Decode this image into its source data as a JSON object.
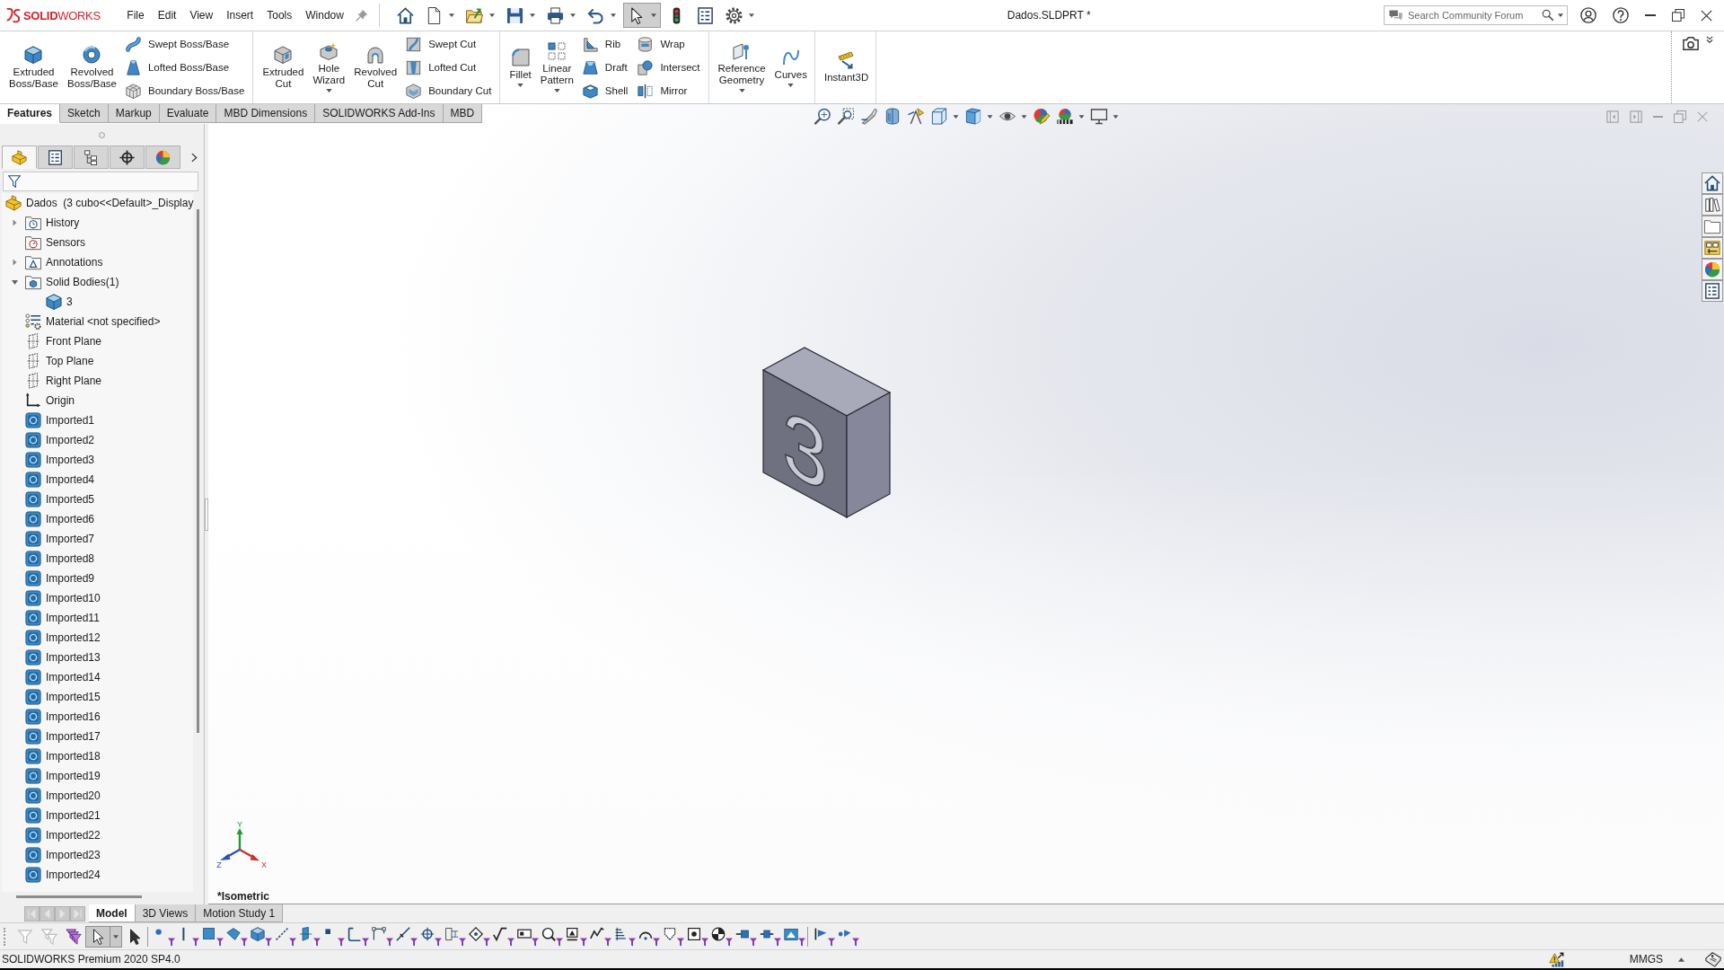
{
  "titlebar": {
    "logo": "**SOLID**WORKS",
    "menus": [
      "File",
      "Edit",
      "View",
      "Insert",
      "Tools",
      "Window"
    ],
    "quick_tools": [
      {
        "dropdown": false,
        "selected": false
      },
      {
        "dropdown": true,
        "selected": false
      },
      {
        "dropdown": true,
        "selected": false
      },
      {
        "dropdown": true,
        "selected": false
      },
      {
        "dropdown": true,
        "selected": false
      },
      {
        "dropdown": true,
        "selected": false
      },
      {
        "dropdown": true,
        "selected": true
      },
      {
        "dropdown": false,
        "selected": false
      },
      {
        "dropdown": false,
        "selected": false
      },
      {
        "dropdown": true,
        "selected": false
      }
    ],
    "title": "Dados.SLDPRT *",
    "search": {
      "placeholder": "Search Community Forum"
    }
  },
  "ribbon": {
    "groups": [
      {
        "columns": [
          {
            "kind": "large",
            "label": "Extruded\nBoss/Base",
            "dropdown": false
          },
          {
            "kind": "large",
            "label": "Revolved\nBoss/Base",
            "dropdown": false
          },
          {
            "kind": "stack",
            "items": [
              "Swept Boss/Base",
              "Lofted Boss/Base",
              "Boundary Boss/Base"
            ]
          }
        ]
      },
      {
        "columns": [
          {
            "kind": "large",
            "label": "Extruded\nCut",
            "dropdown": false
          },
          {
            "kind": "large",
            "label": "Hole\nWizard",
            "dropdown": true
          },
          {
            "kind": "large",
            "label": "Revolved\nCut",
            "dropdown": false
          },
          {
            "kind": "stack",
            "items": [
              "Swept Cut",
              "Lofted Cut",
              "Boundary Cut"
            ]
          }
        ]
      },
      {
        "columns": [
          {
            "kind": "large",
            "label": "Fillet",
            "dropdown": true
          },
          {
            "kind": "large",
            "label": "Linear\nPattern",
            "dropdown": true
          },
          {
            "kind": "stack",
            "items": [
              "Rib",
              "Draft",
              "Shell"
            ]
          },
          {
            "kind": "stack",
            "items": [
              "Wrap",
              "Intersect",
              "Mirror"
            ]
          }
        ]
      },
      {
        "columns": [
          {
            "kind": "large",
            "label": "Reference\nGeometry",
            "dropdown": true
          },
          {
            "kind": "large",
            "label": "Curves",
            "dropdown": true
          }
        ]
      },
      {
        "columns": [
          {
            "kind": "large",
            "label": "Instant3D",
            "dropdown": false
          }
        ]
      }
    ]
  },
  "command_tabs": [
    {
      "label": "Features",
      "selected": true
    },
    {
      "label": "Sketch",
      "selected": false
    },
    {
      "label": "Markup",
      "selected": false
    },
    {
      "label": "Evaluate",
      "selected": false
    },
    {
      "label": "MBD Dimensions",
      "selected": false
    },
    {
      "label": "SOLIDWORKS Add-Ins",
      "selected": false
    },
    {
      "label": "MBD",
      "selected": false
    }
  ],
  "feature_panel": {
    "tabs": [
      {
        "selected": true
      },
      {
        "selected": false
      },
      {
        "selected": false
      },
      {
        "selected": false
      },
      {
        "selected": false
      }
    ],
    "tree": {
      "label": "Dados  (3 cubo<<Default>_Display",
      "kind": "part",
      "children": [
        {
          "label": "History",
          "kind": "history",
          "expanded": false
        },
        {
          "label": "Sensors",
          "kind": "sensors"
        },
        {
          "label": "Annotations",
          "kind": "annotations",
          "expanded": false
        },
        {
          "label": "Solid Bodies(1)",
          "kind": "bodies",
          "expanded": true,
          "children": [
            {
              "label": "3",
              "kind": "body"
            }
          ]
        },
        {
          "label": "Material <not specified>",
          "kind": "material"
        },
        {
          "label": "Front Plane",
          "kind": "plane"
        },
        {
          "label": "Top Plane",
          "kind": "plane"
        },
        {
          "label": "Right Plane",
          "kind": "plane"
        },
        {
          "label": "Origin",
          "kind": "origin"
        },
        {
          "label": "Imported1",
          "kind": "imported"
        },
        {
          "label": "Imported2",
          "kind": "imported"
        },
        {
          "label": "Imported3",
          "kind": "imported"
        },
        {
          "label": "Imported4",
          "kind": "imported"
        },
        {
          "label": "Imported5",
          "kind": "imported"
        },
        {
          "label": "Imported6",
          "kind": "imported"
        },
        {
          "label": "Imported7",
          "kind": "imported"
        },
        {
          "label": "Imported8",
          "kind": "imported"
        },
        {
          "label": "Imported9",
          "kind": "imported"
        },
        {
          "label": "Imported10",
          "kind": "imported"
        },
        {
          "label": "Imported11",
          "kind": "imported"
        },
        {
          "label": "Imported12",
          "kind": "imported"
        },
        {
          "label": "Imported13",
          "kind": "imported"
        },
        {
          "label": "Imported14",
          "kind": "imported"
        },
        {
          "label": "Imported15",
          "kind": "imported"
        },
        {
          "label": "Imported16",
          "kind": "imported"
        },
        {
          "label": "Imported17",
          "kind": "imported"
        },
        {
          "label": "Imported18",
          "kind": "imported"
        },
        {
          "label": "Imported19",
          "kind": "imported"
        },
        {
          "label": "Imported20",
          "kind": "imported"
        },
        {
          "label": "Imported21",
          "kind": "imported"
        },
        {
          "label": "Imported22",
          "kind": "imported"
        },
        {
          "label": "Imported23",
          "kind": "imported"
        },
        {
          "label": "Imported24",
          "kind": "imported"
        }
      ]
    }
  },
  "viewport": {
    "model": {
      "engraving": "3"
    },
    "triad": {
      "x": "X",
      "y": "Y",
      "z": "Z"
    },
    "view_name": "*Isometric"
  },
  "bottom_tabs": {
    "nav_disabled": true,
    "tabs": [
      {
        "label": "Model",
        "selected": true
      },
      {
        "label": "3D Views",
        "selected": false
      },
      {
        "label": "Motion Study 1",
        "selected": false
      }
    ]
  },
  "filter_toolbar": {
    "select_pressed": true
  },
  "status_bar": {
    "product": "SOLIDWORKS Premium 2020 SP4.0",
    "units": "MMGS"
  }
}
